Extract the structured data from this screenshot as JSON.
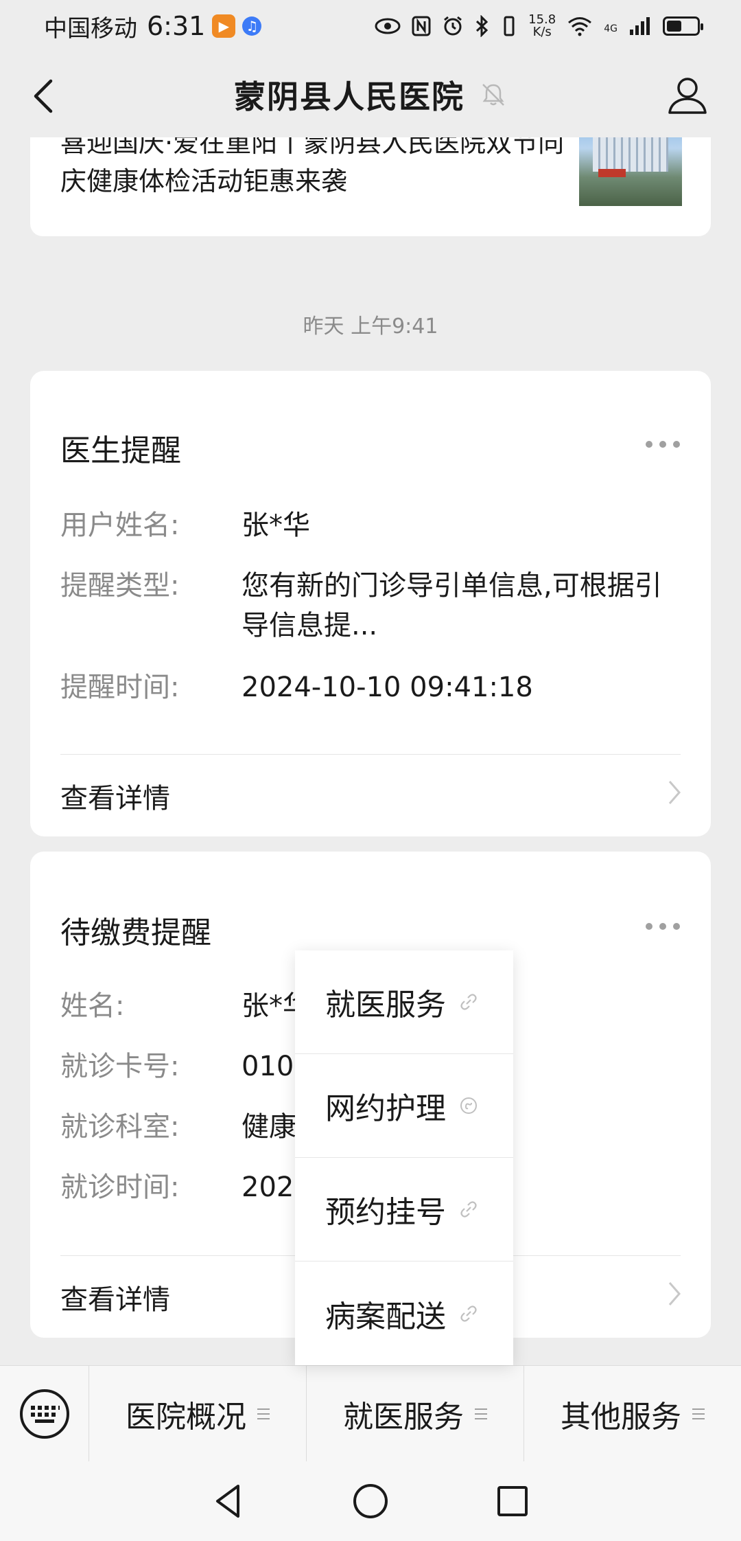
{
  "status_bar": {
    "carrier": "中国移动",
    "time": "6:31",
    "net_speed_value": "15.8",
    "net_speed_unit": "K/s",
    "network_type": "4G"
  },
  "nav": {
    "title": "蒙阴县人民医院"
  },
  "article": {
    "title": "喜迎国庆·爱在重阳丨蒙阴县人民医院双节同庆健康体检活动钜惠来袭"
  },
  "timestamp": "昨天 上午9:41",
  "doctor_reminder": {
    "title": "医生提醒",
    "fields": [
      {
        "label": "用户姓名:",
        "value": "张*华"
      },
      {
        "label": "提醒类型:",
        "value": "您有新的门诊导引单信息,可根据引导信息提..."
      },
      {
        "label": "提醒时间:",
        "value": "2024-10-10 09:41:18"
      }
    ],
    "detail_label": "查看详情"
  },
  "payment_reminder": {
    "title": "待缴费提醒",
    "fields": [
      {
        "label": "姓名:",
        "value": "张*华"
      },
      {
        "label": "就诊卡号:",
        "value": "0101"
      },
      {
        "label": "就诊科室:",
        "value": "健康"
      },
      {
        "label": "就诊时间:",
        "value": "2024"
      }
    ],
    "detail_label": "查看详情"
  },
  "popup_menu": {
    "items": [
      {
        "label": "就医服务",
        "icon": "link-icon"
      },
      {
        "label": "网约护理",
        "icon": "miniprogram-icon"
      },
      {
        "label": "预约挂号",
        "icon": "link-icon"
      },
      {
        "label": "病案配送",
        "icon": "link-icon"
      }
    ]
  },
  "bottom_menu": {
    "tabs": [
      {
        "label": "医院概况"
      },
      {
        "label": "就医服务"
      },
      {
        "label": "其他服务"
      }
    ]
  }
}
